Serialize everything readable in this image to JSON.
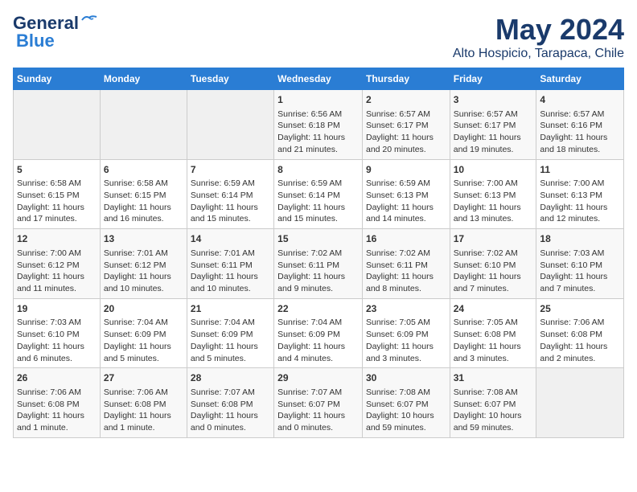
{
  "header": {
    "logo_line1": "General",
    "logo_line2": "Blue",
    "title": "May 2024",
    "subtitle": "Alto Hospicio, Tarapaca, Chile"
  },
  "days_of_week": [
    "Sunday",
    "Monday",
    "Tuesday",
    "Wednesday",
    "Thursday",
    "Friday",
    "Saturday"
  ],
  "weeks": [
    [
      {
        "day": "",
        "content": ""
      },
      {
        "day": "",
        "content": ""
      },
      {
        "day": "",
        "content": ""
      },
      {
        "day": "1",
        "content": "Sunrise: 6:56 AM\nSunset: 6:18 PM\nDaylight: 11 hours and 21 minutes."
      },
      {
        "day": "2",
        "content": "Sunrise: 6:57 AM\nSunset: 6:17 PM\nDaylight: 11 hours and 20 minutes."
      },
      {
        "day": "3",
        "content": "Sunrise: 6:57 AM\nSunset: 6:17 PM\nDaylight: 11 hours and 19 minutes."
      },
      {
        "day": "4",
        "content": "Sunrise: 6:57 AM\nSunset: 6:16 PM\nDaylight: 11 hours and 18 minutes."
      }
    ],
    [
      {
        "day": "5",
        "content": "Sunrise: 6:58 AM\nSunset: 6:15 PM\nDaylight: 11 hours and 17 minutes."
      },
      {
        "day": "6",
        "content": "Sunrise: 6:58 AM\nSunset: 6:15 PM\nDaylight: 11 hours and 16 minutes."
      },
      {
        "day": "7",
        "content": "Sunrise: 6:59 AM\nSunset: 6:14 PM\nDaylight: 11 hours and 15 minutes."
      },
      {
        "day": "8",
        "content": "Sunrise: 6:59 AM\nSunset: 6:14 PM\nDaylight: 11 hours and 15 minutes."
      },
      {
        "day": "9",
        "content": "Sunrise: 6:59 AM\nSunset: 6:13 PM\nDaylight: 11 hours and 14 minutes."
      },
      {
        "day": "10",
        "content": "Sunrise: 7:00 AM\nSunset: 6:13 PM\nDaylight: 11 hours and 13 minutes."
      },
      {
        "day": "11",
        "content": "Sunrise: 7:00 AM\nSunset: 6:13 PM\nDaylight: 11 hours and 12 minutes."
      }
    ],
    [
      {
        "day": "12",
        "content": "Sunrise: 7:00 AM\nSunset: 6:12 PM\nDaylight: 11 hours and 11 minutes."
      },
      {
        "day": "13",
        "content": "Sunrise: 7:01 AM\nSunset: 6:12 PM\nDaylight: 11 hours and 10 minutes."
      },
      {
        "day": "14",
        "content": "Sunrise: 7:01 AM\nSunset: 6:11 PM\nDaylight: 11 hours and 10 minutes."
      },
      {
        "day": "15",
        "content": "Sunrise: 7:02 AM\nSunset: 6:11 PM\nDaylight: 11 hours and 9 minutes."
      },
      {
        "day": "16",
        "content": "Sunrise: 7:02 AM\nSunset: 6:11 PM\nDaylight: 11 hours and 8 minutes."
      },
      {
        "day": "17",
        "content": "Sunrise: 7:02 AM\nSunset: 6:10 PM\nDaylight: 11 hours and 7 minutes."
      },
      {
        "day": "18",
        "content": "Sunrise: 7:03 AM\nSunset: 6:10 PM\nDaylight: 11 hours and 7 minutes."
      }
    ],
    [
      {
        "day": "19",
        "content": "Sunrise: 7:03 AM\nSunset: 6:10 PM\nDaylight: 11 hours and 6 minutes."
      },
      {
        "day": "20",
        "content": "Sunrise: 7:04 AM\nSunset: 6:09 PM\nDaylight: 11 hours and 5 minutes."
      },
      {
        "day": "21",
        "content": "Sunrise: 7:04 AM\nSunset: 6:09 PM\nDaylight: 11 hours and 5 minutes."
      },
      {
        "day": "22",
        "content": "Sunrise: 7:04 AM\nSunset: 6:09 PM\nDaylight: 11 hours and 4 minutes."
      },
      {
        "day": "23",
        "content": "Sunrise: 7:05 AM\nSunset: 6:09 PM\nDaylight: 11 hours and 3 minutes."
      },
      {
        "day": "24",
        "content": "Sunrise: 7:05 AM\nSunset: 6:08 PM\nDaylight: 11 hours and 3 minutes."
      },
      {
        "day": "25",
        "content": "Sunrise: 7:06 AM\nSunset: 6:08 PM\nDaylight: 11 hours and 2 minutes."
      }
    ],
    [
      {
        "day": "26",
        "content": "Sunrise: 7:06 AM\nSunset: 6:08 PM\nDaylight: 11 hours and 1 minute."
      },
      {
        "day": "27",
        "content": "Sunrise: 7:06 AM\nSunset: 6:08 PM\nDaylight: 11 hours and 1 minute."
      },
      {
        "day": "28",
        "content": "Sunrise: 7:07 AM\nSunset: 6:08 PM\nDaylight: 11 hours and 0 minutes."
      },
      {
        "day": "29",
        "content": "Sunrise: 7:07 AM\nSunset: 6:07 PM\nDaylight: 11 hours and 0 minutes."
      },
      {
        "day": "30",
        "content": "Sunrise: 7:08 AM\nSunset: 6:07 PM\nDaylight: 10 hours and 59 minutes."
      },
      {
        "day": "31",
        "content": "Sunrise: 7:08 AM\nSunset: 6:07 PM\nDaylight: 10 hours and 59 minutes."
      },
      {
        "day": "",
        "content": ""
      }
    ]
  ]
}
